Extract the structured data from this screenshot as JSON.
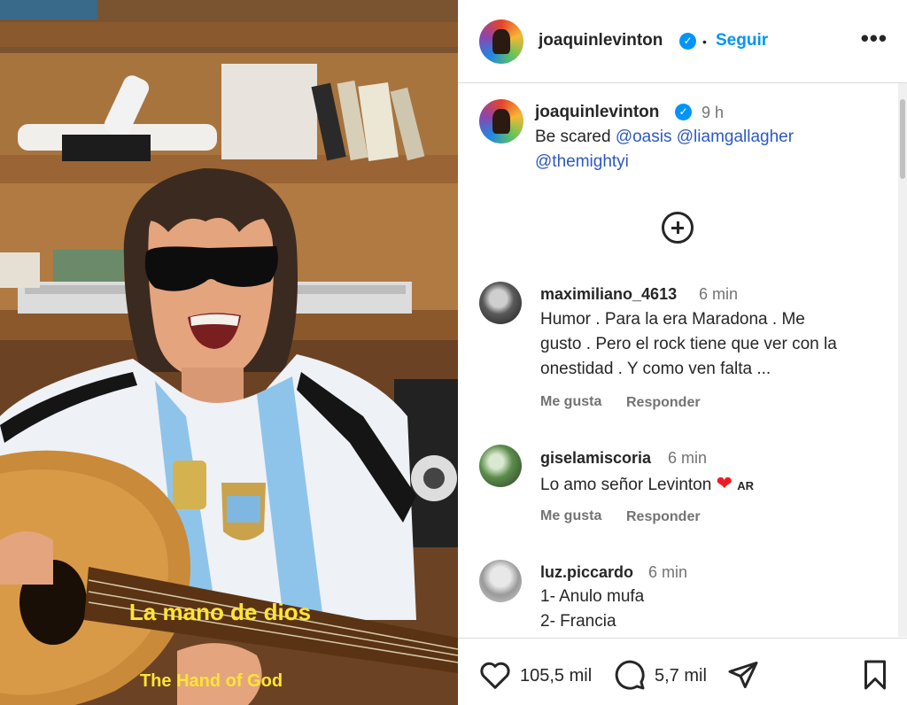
{
  "media": {
    "caption_es": "La mano de dios",
    "caption_en": "The Hand of God"
  },
  "header": {
    "username": "joaquinlevinton",
    "separator": "•",
    "follow_label": "Seguir",
    "more_label": "•••"
  },
  "post": {
    "username": "joaquinlevinton",
    "time": "9 h",
    "text_prefix": "Be scared",
    "mentions": [
      "@oasis",
      "@liamgallagher",
      "@themightyi"
    ]
  },
  "comments": [
    {
      "username": "maximiliano_4613",
      "time": "6 min",
      "lines": [
        "Humor . Para la era Maradona . Me",
        "gusto . Pero el rock tiene que ver con la",
        "onestidad . Y como ven falta ..."
      ],
      "like_label": "Me gusta",
      "reply_label": "Responder"
    },
    {
      "username": "giselamiscoria",
      "time": "6 min",
      "lines": [
        "Lo amo señor Levinton"
      ],
      "flag_code": "AR",
      "like_label": "Me gusta",
      "reply_label": "Responder"
    },
    {
      "username": "luz.piccardo",
      "time": "6 min",
      "lines": [
        "1- Anulo mufa",
        "2- Francia"
      ]
    }
  ],
  "footer": {
    "likes": "105,5 mil",
    "comments": "5,7 mil"
  },
  "colors": {
    "accent": "#0095f6",
    "caption": "#ffe534",
    "muted": "#737373"
  }
}
